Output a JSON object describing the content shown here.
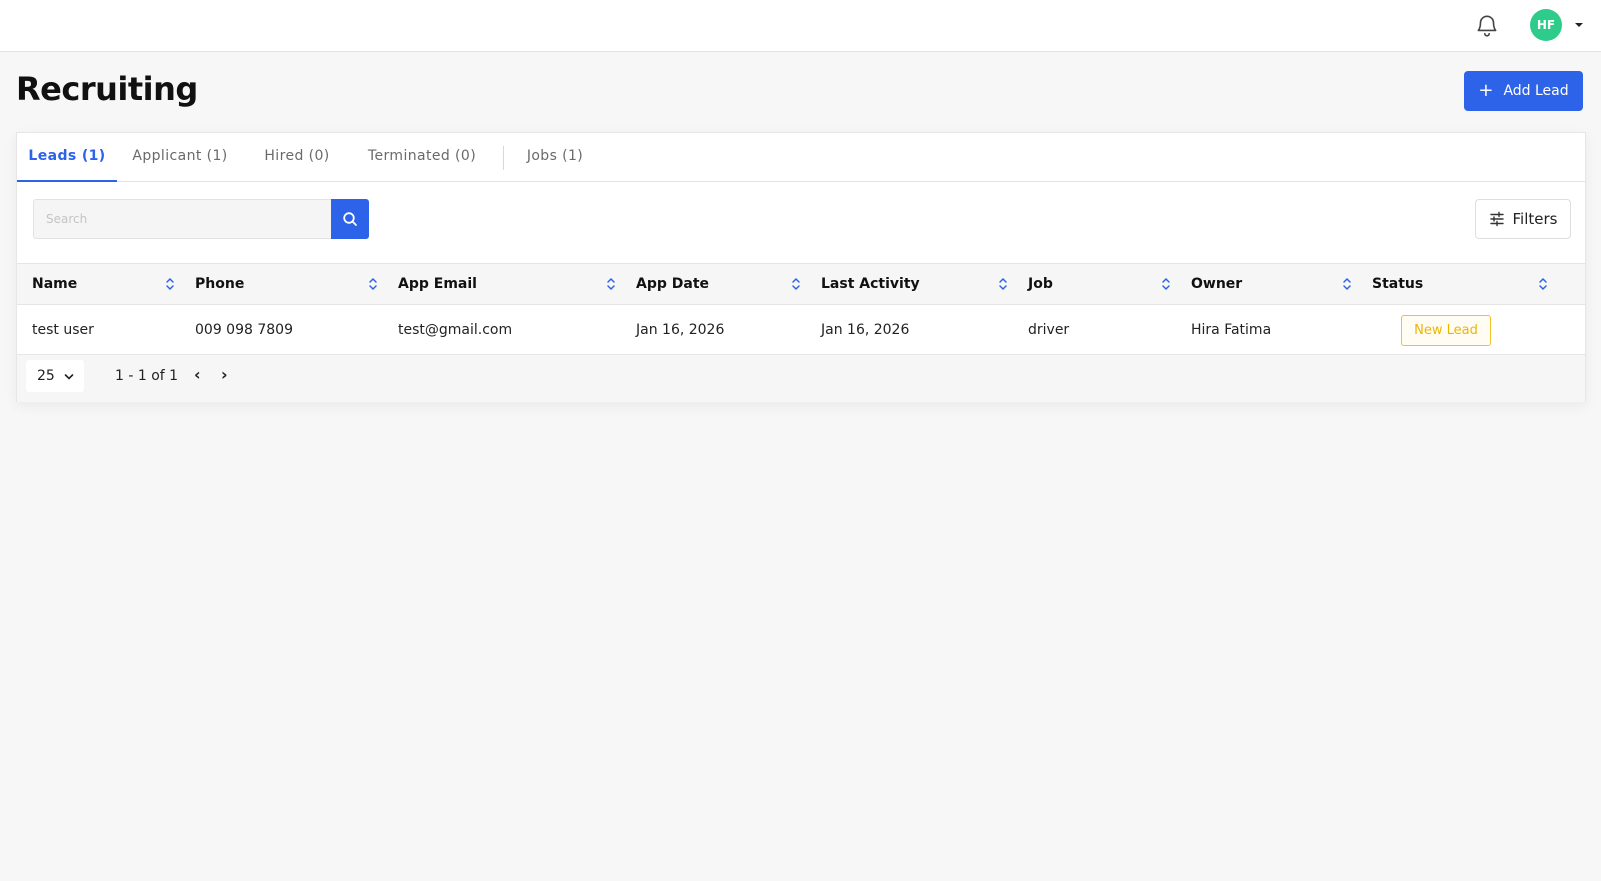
{
  "header": {
    "avatar_initials": "HF",
    "avatar_color": "#2ecc8a"
  },
  "page": {
    "title": "Recruiting",
    "add_button_label": "Add Lead",
    "accent_color": "#2d63e8"
  },
  "tabs": [
    {
      "label": "Leads (1)",
      "active": true
    },
    {
      "label": "Applicant (1)",
      "active": false
    },
    {
      "label": "Hired (0)",
      "active": false
    },
    {
      "label": "Terminated (0)",
      "active": false
    },
    {
      "label": "Jobs (1)",
      "active": false
    }
  ],
  "search": {
    "placeholder": "Search",
    "value": ""
  },
  "filters_label": "Filters",
  "table": {
    "columns": [
      "Name",
      "Phone",
      "App Email",
      "App Date",
      "Last Activity",
      "Job",
      "Owner",
      "Status"
    ],
    "rows": [
      {
        "name": "test user",
        "phone": "009 098 7809",
        "email": "test@gmail.com",
        "app_date": "Jan 16, 2026",
        "last_activity": "Jan 16, 2026",
        "job": "driver",
        "owner": "Hira Fatima",
        "status": "New Lead",
        "status_color": "#f0b400"
      }
    ]
  },
  "pagination": {
    "page_size": "25",
    "range": "1 - 1 of 1",
    "prev": "‹",
    "next": "›"
  }
}
